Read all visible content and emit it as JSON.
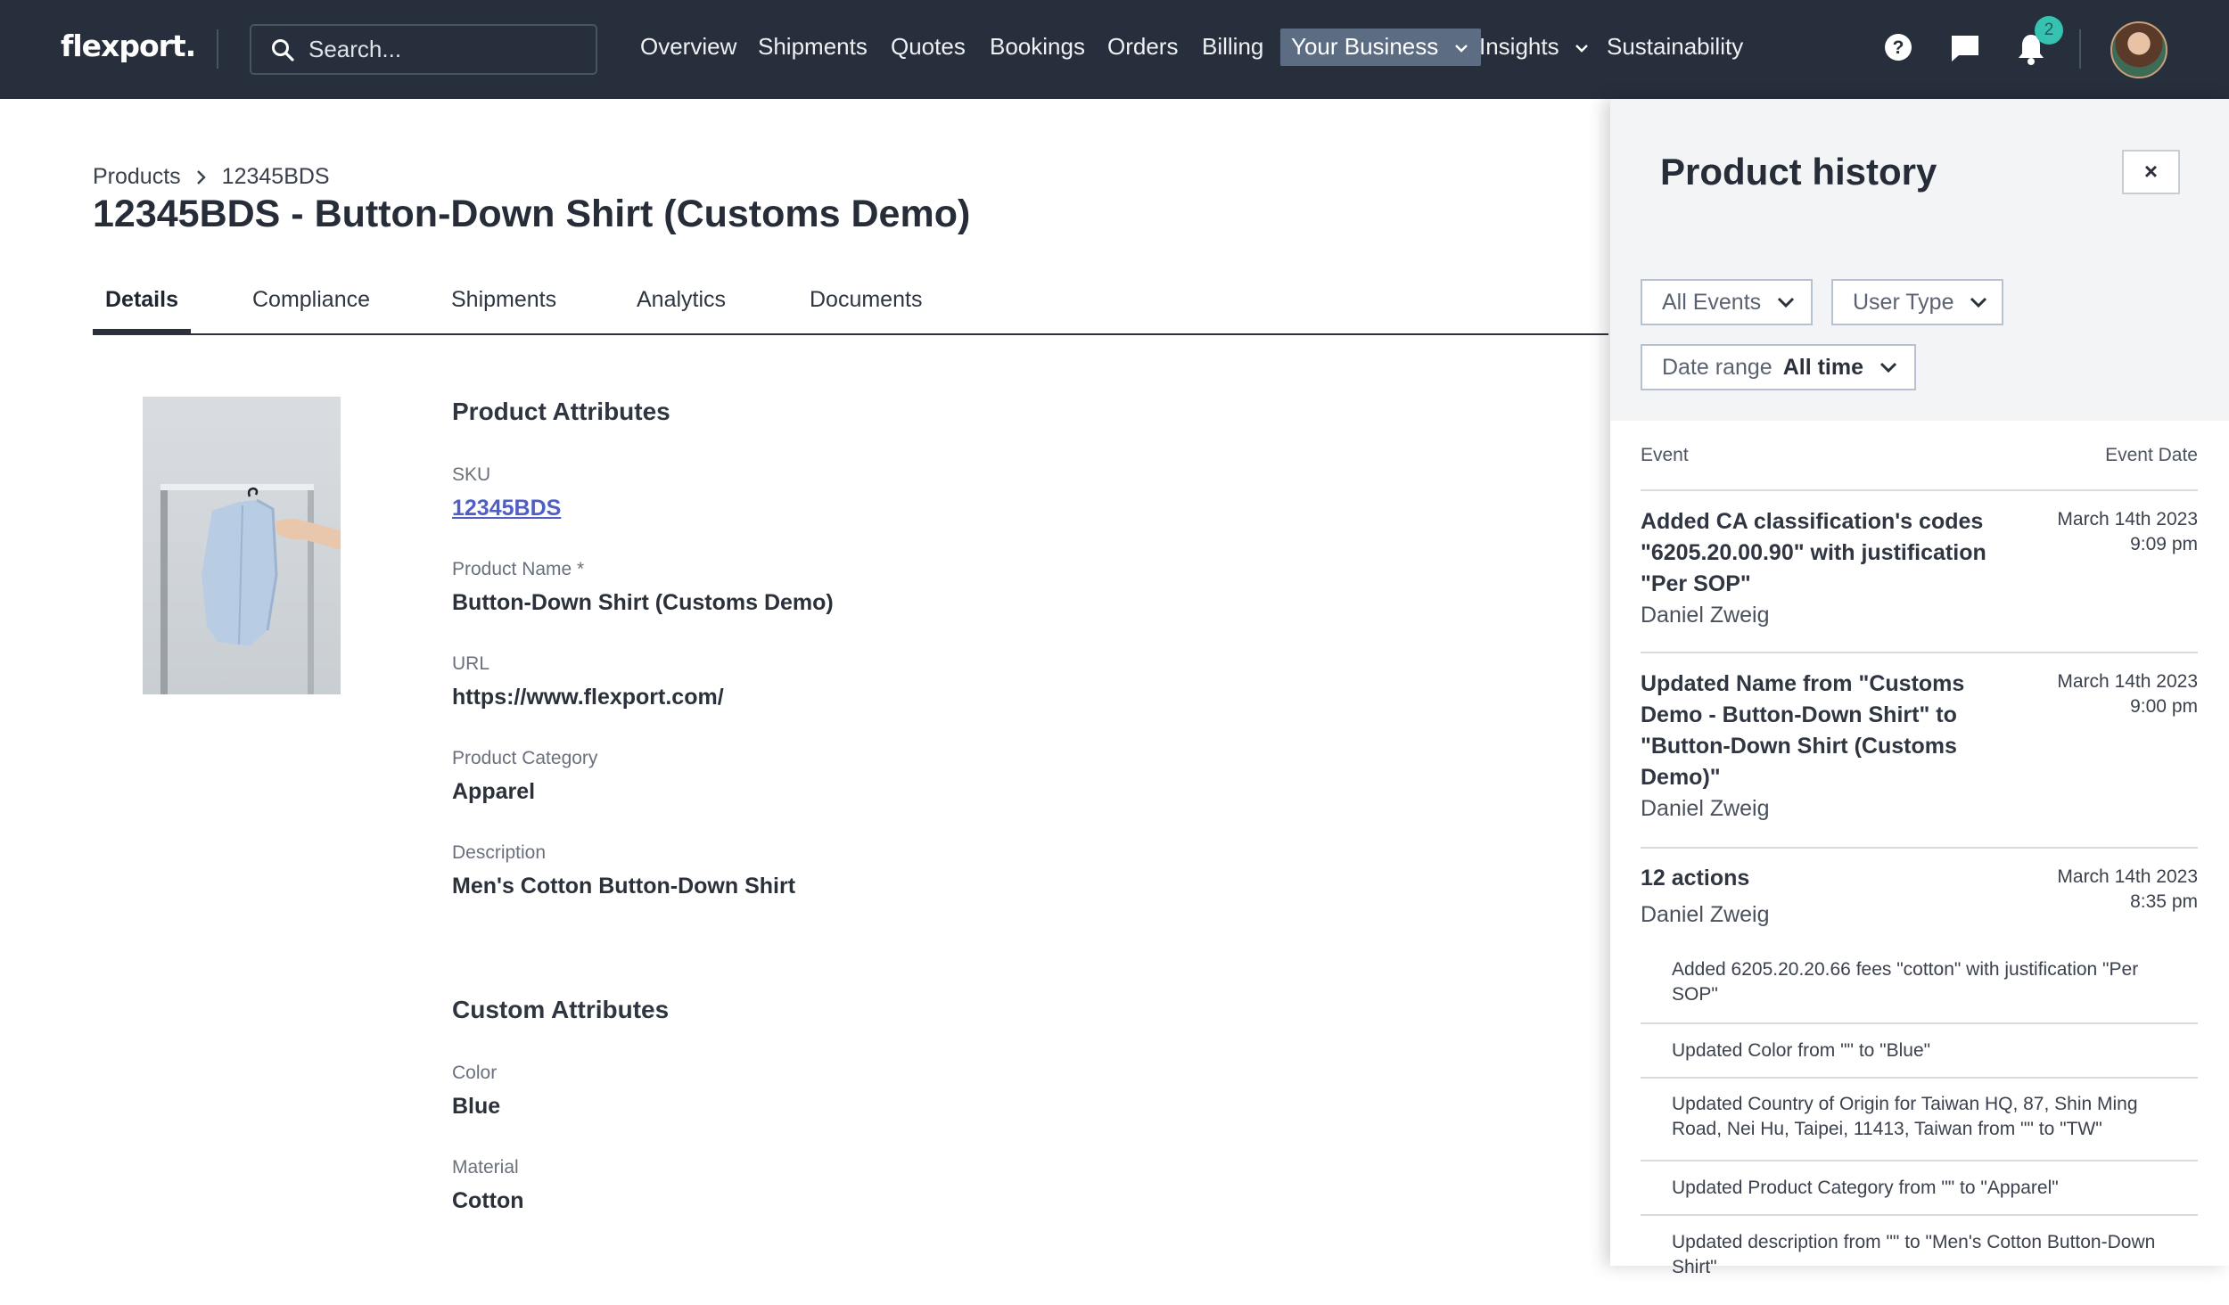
{
  "topbar": {
    "logo": "flexport.",
    "search_placeholder": "Search...",
    "nav": [
      "Overview",
      "Shipments",
      "Quotes",
      "Bookings",
      "Orders",
      "Billing",
      "Your Business",
      "Insights",
      "Sustainability"
    ],
    "notification_count": "2"
  },
  "breadcrumb": {
    "root": "Products",
    "current": "12345BDS"
  },
  "page_title": "12345BDS - Button-Down Shirt (Customs Demo)",
  "tabs": [
    "Details",
    "Compliance",
    "Shipments",
    "Analytics",
    "Documents"
  ],
  "product_attributes": {
    "title": "Product Attributes",
    "sku_label": "SKU",
    "sku_value": "12345BDS",
    "name_label": "Product Name *",
    "name_value": "Button-Down Shirt (Customs Demo)",
    "url_label": "URL",
    "url_value": "https://www.flexport.com/",
    "category_label": "Product Category",
    "category_value": "Apparel",
    "description_label": "Description",
    "description_value": "Men's Cotton Button-Down Shirt"
  },
  "custom_attributes": {
    "title": "Custom Attributes",
    "color_label": "Color",
    "color_value": "Blue",
    "material_label": "Material",
    "material_value": "Cotton"
  },
  "history": {
    "title": "Product history",
    "close": "×",
    "filters": {
      "events": "All Events",
      "user_type": "User Type",
      "date_label": "Date range",
      "date_value": "All time"
    },
    "col_event": "Event",
    "col_date": "Event Date",
    "events": [
      {
        "title": "Added CA classification's codes \"6205.20.00.90\" with justification \"Per SOP\"",
        "user": "Daniel Zweig",
        "date": "March 14th 2023",
        "time": "9:09 pm"
      },
      {
        "title": "Updated Name from \"Customs Demo - Button-Down Shirt\" to \"Button-Down Shirt (Customs Demo)\"",
        "user": "Daniel Zweig",
        "date": "March 14th 2023",
        "time": "9:00 pm"
      },
      {
        "title": "12 actions",
        "user": "Daniel Zweig",
        "date": "March 14th 2023",
        "time": "8:35 pm"
      }
    ],
    "actions": [
      "Added 6205.20.20.66 fees \"cotton\" with justification \"Per SOP\"",
      "Updated Color from \"\" to \"Blue\"",
      "Updated Country of Origin for Taiwan HQ, 87, Shin Ming Road, Nei Hu, Taipei, 11413, Taiwan from \"\" to \"TW\"",
      "Updated Product Category from \"\" to \"Apparel\"",
      "Updated description from \"\" to \"Men's Cotton Button-Down Shirt\""
    ]
  }
}
